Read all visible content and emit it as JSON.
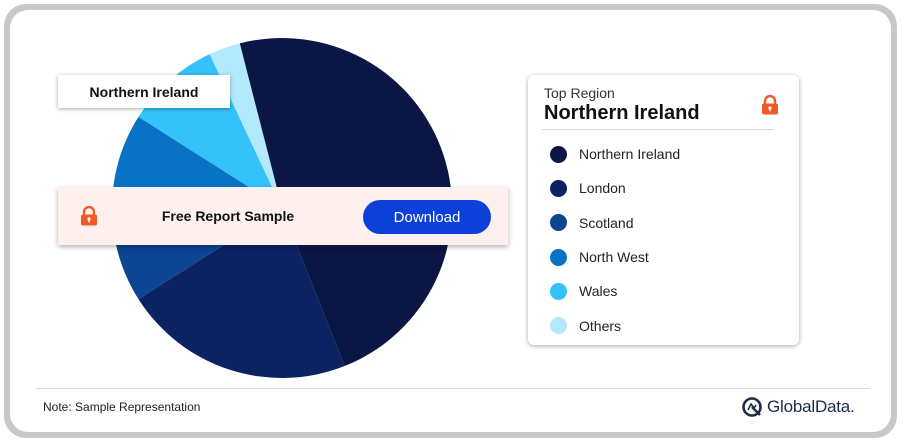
{
  "chart_data": {
    "type": "pie",
    "slices": [
      {
        "label": "Northern Ireland",
        "value": 48,
        "color": "#0c1645"
      },
      {
        "label": "London",
        "value": 22,
        "color": "#0b2363"
      },
      {
        "label": "Scotland",
        "value": 11,
        "color": "#0c4592"
      },
      {
        "label": "North West",
        "value": 7,
        "color": "#0972c4"
      },
      {
        "label": "Wales",
        "value": 9,
        "color": "#33c2fa"
      },
      {
        "label": "Others",
        "value": 3,
        "color": "#b3e9fd"
      }
    ]
  },
  "callout": {
    "label": "Northern Ireland"
  },
  "banner": {
    "title": "Free Report Sample",
    "button_label": "Download"
  },
  "legend": {
    "subtitle": "Top Region",
    "title": "Northern Ireland",
    "items": [
      "Northern Ireland",
      "London",
      "Scotland",
      "North West",
      "Wales",
      "Others"
    ]
  },
  "footer": {
    "note": "Note: Sample Representation",
    "brand": "GlobalData."
  },
  "icons": {
    "lock": "lock-icon",
    "logo": "globaldata-logo-icon"
  },
  "colors": {
    "lock": "#f05a28",
    "button": "#0d3fd9"
  }
}
